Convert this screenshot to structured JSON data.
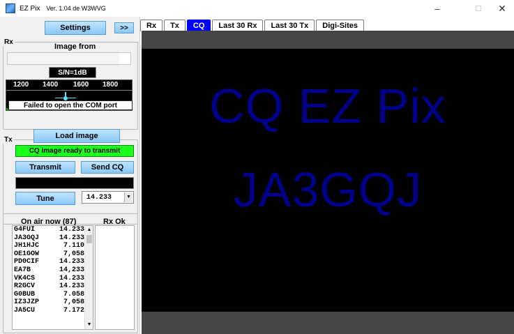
{
  "window": {
    "app_name": "EZ Pix",
    "version": "Ver. 1.04 de W3WVG",
    "minimize": "–",
    "maximize": "☐",
    "close": "✕"
  },
  "left": {
    "settings_label": "Settings",
    "more_label": ">>",
    "rx": {
      "group_label": "Rx",
      "image_from_label": "Image from",
      "image_from_value": "",
      "snr": "S/N=1dB",
      "waterfall_ticks": [
        "1200",
        "1400",
        "1600",
        "1800"
      ],
      "com_error": "Failed to open the COM port"
    },
    "tx": {
      "group_label": "Tx",
      "load_image_label": "Load image",
      "status": "CQ image ready to transmit",
      "status_color": "#1aff1a",
      "transmit_label": "Transmit",
      "send_cq_label": "Send CQ",
      "tune_label": "Tune",
      "frequency": "14.233"
    },
    "onair": {
      "title": "On air now (87)",
      "rx_ok_title": "Rx Ok",
      "stations": [
        {
          "call": "G4FUI",
          "freq": "14.233"
        },
        {
          "call": "JA3GQJ",
          "freq": "14.233"
        },
        {
          "call": "JH1HJC",
          "freq": "7.110"
        },
        {
          "call": "OE1GOW",
          "freq": "7,058"
        },
        {
          "call": "PD0CIF",
          "freq": "14.233"
        },
        {
          "call": "EA7B",
          "freq": "14,233"
        },
        {
          "call": "VK4CS",
          "freq": "14.233"
        },
        {
          "call": "R2GCV",
          "freq": "14.233"
        },
        {
          "call": "G0BUB",
          "freq": "7.058"
        },
        {
          "call": "IZ3JZP",
          "freq": "7,058"
        },
        {
          "call": "JA5CU",
          "freq": "7.172"
        }
      ]
    }
  },
  "tabs": [
    "Rx",
    "Tx",
    "CQ",
    "Last 30 Rx",
    "Last 30 Tx",
    "Digi-Sites"
  ],
  "active_tab": "CQ",
  "accent_color": "#0000ff",
  "cq_image": {
    "line1": "CQ EZ Pix",
    "line2": "JA3GQJ",
    "text_color": "#00008b"
  }
}
